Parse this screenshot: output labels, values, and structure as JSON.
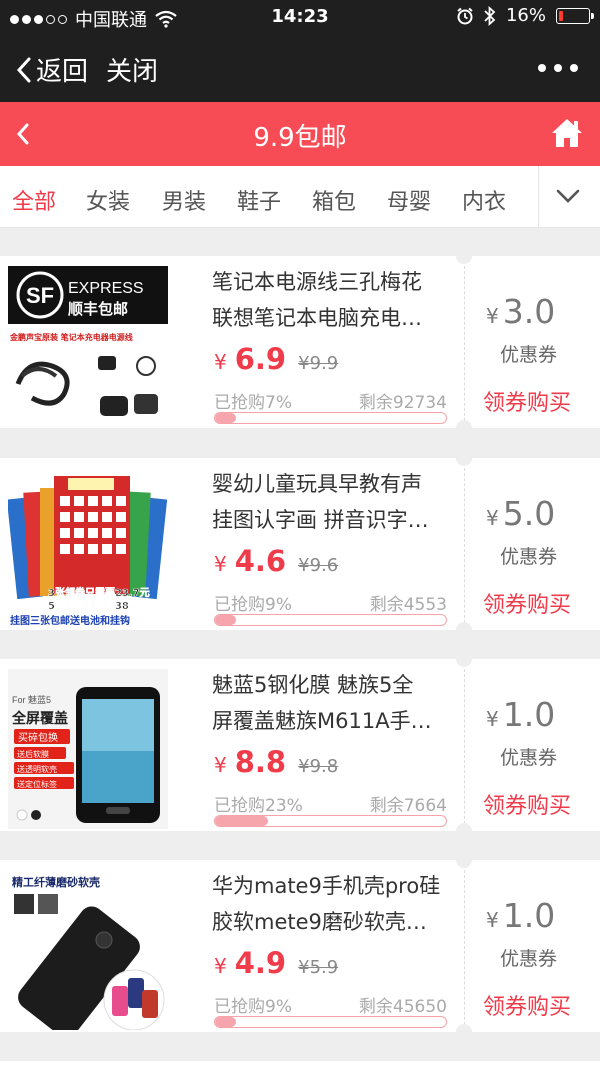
{
  "status_bar": {
    "carrier": "中国联通",
    "time": "14:23",
    "battery": "16%",
    "battery_level": 0.16
  },
  "nav": {
    "back_label": "返回",
    "close_label": "关闭"
  },
  "header": {
    "title": "9.9包邮"
  },
  "tabs": [
    "全部",
    "女装",
    "男装",
    "鞋子",
    "箱包",
    "母婴",
    "内衣"
  ],
  "active_tab": 0,
  "colors": {
    "accent": "#f74b55",
    "price": "#f03b4a",
    "dark": "#1f1f20"
  },
  "labels": {
    "coupon": "优惠券",
    "buy": "领券购买",
    "yen": "¥",
    "sold_prefix": "已抢购",
    "remain_prefix": "剩余"
  },
  "products": [
    {
      "title_line1": "笔记本电源线三孔梅花",
      "title_line2": "联想笔记本电脑充电…",
      "price": "6.9",
      "orig_price": "9.9",
      "sold": "7%",
      "sold_fraction": 0.07,
      "remain": "92734",
      "coupon_value": "3.0",
      "image_texts": {
        "badge": "SF",
        "brand": "EXPRESS",
        "ship": "顺丰包邮",
        "caption": "金鹏声宝原装 笔记本充电器电源线"
      }
    },
    {
      "title_line1": "婴幼儿童玩具早教有声",
      "title_line2": "挂图认字画 拼音识字…",
      "price": "4.6",
      "orig_price": "9.6",
      "sold": "9%",
      "sold_fraction": 0.09,
      "remain": "4553",
      "coupon_value": "5.0",
      "image_texts": {
        "promo1": "3张领券只需要23.7元",
        "promo2": "5张领券只需要38元",
        "caption": "挂图三张包邮送电池和挂钩"
      }
    },
    {
      "title_line1": "魅蓝5钢化膜 魅族5全",
      "title_line2": "屏覆盖魅族M611A手…",
      "price": "8.8",
      "orig_price": "9.8",
      "sold": "23%",
      "sold_fraction": 0.23,
      "remain": "7664",
      "coupon_value": "1.0",
      "image_texts": {
        "for": "For 魅蓝5",
        "cover": "全屏覆盖",
        "tag1": "买碎包换",
        "tag2": "送后软膜",
        "tag3": "送透明软壳",
        "tag4": "送定位标签"
      }
    },
    {
      "title_line1": "华为mate9手机壳pro硅",
      "title_line2": "胶软mete9磨砂软壳…",
      "price": "4.9",
      "orig_price": "5.9",
      "sold": "9%",
      "sold_fraction": 0.09,
      "remain": "45650",
      "coupon_value": "1.0",
      "image_texts": {
        "headline": "精工纤薄磨砂软壳"
      }
    }
  ]
}
